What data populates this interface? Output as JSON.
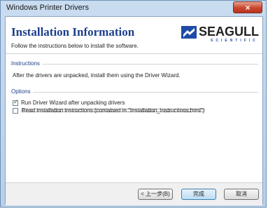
{
  "window": {
    "title": "Windows Printer Drivers",
    "close_label": "×"
  },
  "header": {
    "title": "Installation Information",
    "subtitle": "Follow the instructions below to install the software.",
    "logo": {
      "name": "SEAGULL",
      "sub": "SCIENTIFIC"
    }
  },
  "instructions": {
    "label": "Instructions",
    "text": "After the drivers are unpacked, install them using the Driver Wizard."
  },
  "options": {
    "label": "Options",
    "items": [
      {
        "label": "Run Driver Wizard after unpacking drivers",
        "checked": true
      },
      {
        "label": "Read installation instructions (contained in \"Installation_Instructions.html\")",
        "checked": false
      }
    ]
  },
  "buttons": {
    "back": "< 上一步(B)",
    "finish": "完成",
    "cancel": "取消"
  }
}
